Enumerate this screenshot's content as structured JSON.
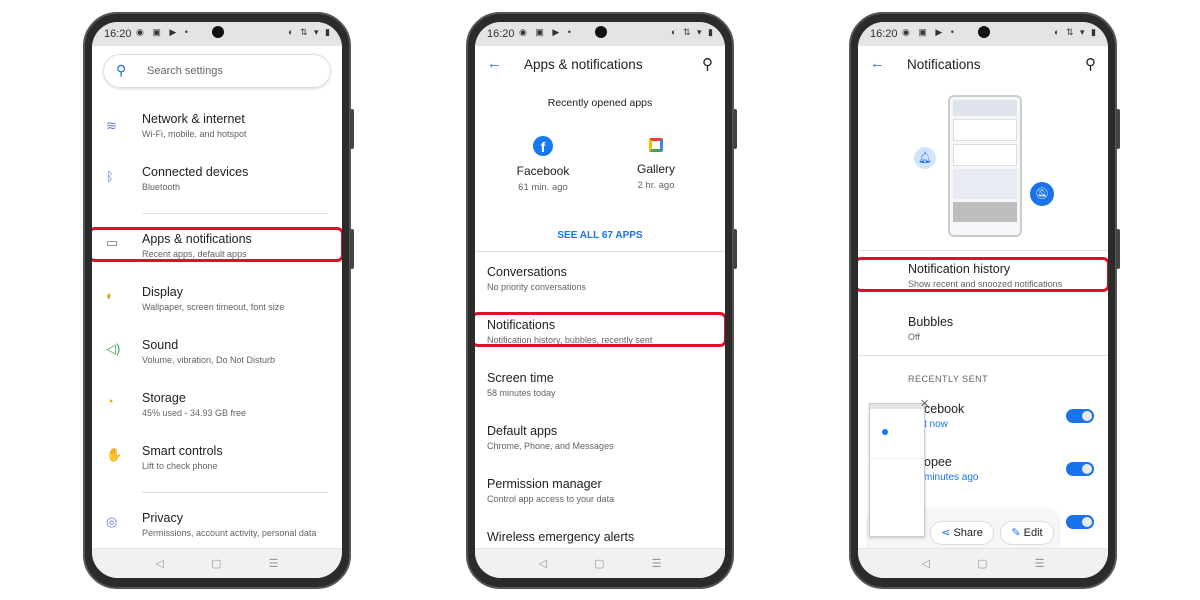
{
  "status": {
    "time": "16:20"
  },
  "phone1": {
    "search_placeholder": "Search settings",
    "items": [
      {
        "title": "Network & internet",
        "subtitle": "Wi-Fi, mobile, and hotspot",
        "icon": "wifi-icon"
      },
      {
        "title": "Connected devices",
        "subtitle": "Bluetooth",
        "icon": "bluetooth-icon"
      },
      {
        "title": "Apps & notifications",
        "subtitle": "Recent apps, default apps",
        "icon": "apps-icon"
      },
      {
        "title": "Display",
        "subtitle": "Wallpaper, screen timeout, font size",
        "icon": "display-icon"
      },
      {
        "title": "Sound",
        "subtitle": "Volume, vibration, Do Not Disturb",
        "icon": "sound-icon"
      },
      {
        "title": "Storage",
        "subtitle": "45% used - 34.93 GB free",
        "icon": "storage-icon"
      },
      {
        "title": "Smart controls",
        "subtitle": "Lift to check phone",
        "icon": "hand-icon"
      },
      {
        "title": "Privacy",
        "subtitle": "Permissions, account activity, personal data",
        "icon": "privacy-icon"
      }
    ]
  },
  "phone2": {
    "title": "Apps & notifications",
    "recent_label": "Recently opened apps",
    "apps": [
      {
        "name": "Facebook",
        "time": "61 min. ago"
      },
      {
        "name": "Gallery",
        "time": "2 hr. ago"
      }
    ],
    "see_all": "SEE ALL 67 APPS",
    "items": [
      {
        "title": "Conversations",
        "subtitle": "No priority conversations"
      },
      {
        "title": "Notifications",
        "subtitle": "Notification history, bubbles, recently sent"
      },
      {
        "title": "Screen time",
        "subtitle": "58 minutes today"
      },
      {
        "title": "Default apps",
        "subtitle": "Chrome, Phone, and Messages"
      },
      {
        "title": "Permission manager",
        "subtitle": "Control app access to your data"
      },
      {
        "title": "Wireless emergency alerts",
        "subtitle": ""
      }
    ]
  },
  "phone3": {
    "title": "Notifications",
    "items": [
      {
        "title": "Notification history",
        "subtitle": "Show recent and snoozed notifications"
      },
      {
        "title": "Bubbles",
        "subtitle": "Off"
      }
    ],
    "recently_sent": "RECENTLY SENT",
    "recent": [
      {
        "title": "cebook",
        "subtitle": "t now",
        "enabled": true
      },
      {
        "title": "opee",
        "subtitle": "minutes ago",
        "enabled": true
      },
      {
        "title": "",
        "subtitle": "",
        "enabled": true
      }
    ],
    "screenshot_actions": {
      "share": "Share",
      "edit": "Edit"
    }
  },
  "colors": {
    "accent": "#1a73e8",
    "highlight": "#e0102a"
  }
}
